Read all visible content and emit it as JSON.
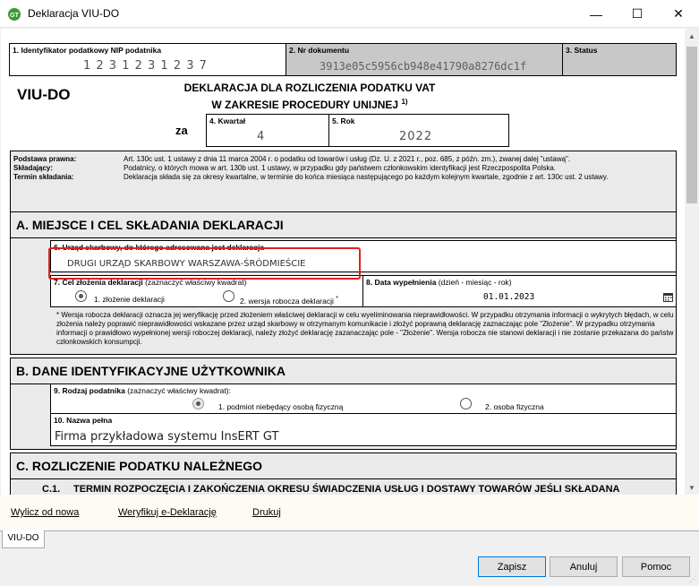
{
  "window": {
    "title": "Deklaracja VIU-DO",
    "minimize": "—",
    "maximize": "☐",
    "close": "✕"
  },
  "header": {
    "nip_label_num": "1.",
    "nip_label": "Identyfikator podatkowy NIP podatnika",
    "nip_value": "1 2 3 1 2 3 1 2 3 7",
    "doc_label_num": "2.",
    "doc_label": "Nr dokumentu",
    "doc_value": "3913e05c5956cb948e41790a8276dc1f",
    "status_label_num": "3.",
    "status_label": "Status",
    "form_code": "VIU-DO",
    "title_line1": "DEKLARACJA DLA ROZLICZENIA PODATKU VAT",
    "title_line2": "W ZAKRESIE PROCEDURY UNIJNEJ",
    "title_sup": "1)",
    "za": "za",
    "quarter_label_num": "4.",
    "quarter_label": "Kwartał",
    "quarter_value": "4",
    "year_label_num": "5.",
    "year_label": "Rok",
    "year_value": "2022"
  },
  "legal": {
    "basis_key": "Podstawa prawna:",
    "basis_val": "Art. 130c ust. 1 ustawy z dnia 11 marca 2004 r. o podatku od towarów i usług (Dz. U. z 2021 r., poz. 685, z późn. zm.), zwanej dalej \"ustawą\".",
    "filer_key": "Składający:",
    "filer_val": "Podatnicy, o których mowa w art. 130b ust. 1 ustawy, w przypadku gdy państwem członkowskim identyfikacji jest Rzeczpospolita Polska.",
    "deadline_key": "Termin składania:",
    "deadline_val": "Deklaracja składa się za okresy kwartalne, w terminie do końca miesiąca następującego po każdym kolejnym kwartale, zgodnie z art. 130c ust. 2 ustawy."
  },
  "section_a": {
    "title": "A. MIEJSCE I CEL SKŁADANIA DEKLARACJI",
    "office_label": "6. Urząd skarbowy, do którego adresowana jest deklaracja",
    "office_value": "DRUGI URZĄD SKARBOWY WARSZAWA-ŚRÓDMIEŚCIE",
    "purpose_label": "7. Cel złożenia deklaracji",
    "purpose_hint": "(zaznaczyć właściwy kwadrat)",
    "purpose_opt1": "1. złożenie deklaracji",
    "purpose_opt2": "2. wersja robocza deklaracji",
    "purpose_opt2_sup": "*",
    "date_label": "8. Data wypełnienia",
    "date_hint": "(dzień - miesiąc - rok)",
    "date_value": "01.01.2023",
    "note": "* Wersja robocza deklaracji oznacza jej weryfikację przed złożeniem właściwej deklaracji w celu wyeliminowania nieprawidłowości. W przypadku otrzymania informacji o wykrytych błędach, w celu złożenia należy poprawić nieprawidłowości wskazane przez urząd skarbowy w otrzymanym komunikacie i złożyć poprawną deklarację zaznaczając pole \"Złożenie\". W przypadku otrzymania informacji o prawidłowo wypełnionej wersji roboczej deklaracji, należy złożyć deklarację zazanaczając pole - \"Złożenie\". Wersja robocza nie stanowi deklaracji i nie zostanie przekazana do państw członkowskich konsumpcji."
  },
  "section_b": {
    "title": "B. DANE IDENTYFIKACYJNE UŻYTKOWNIKA",
    "type_label": "9. Rodzaj podatnika",
    "type_hint": "(zaznaczyć właściwy kwadrat):",
    "type_opt1": "1. podmiot niebędący osobą fizyczną",
    "type_opt2": "2. osoba fizyczna",
    "name_label": "10. Nazwa pełna",
    "name_value": "Firma przykładowa systemu InsERT GT"
  },
  "section_c": {
    "title": "C. ROZLICZENIE PODATKU NALEŻNEGO",
    "sub_num": "C.1.",
    "sub_title": "TERMIN ROZPOCZĘCIA I ZAKOŃCZENIA OKRESU ŚWIADCZENIA USŁUG I DOSTAWY TOWARÓW JEŚLI SKŁADANA"
  },
  "links": {
    "recalc": "Wylicz od nowa",
    "verify": "Weryfikuj e-Deklarację",
    "print": "Drukuj"
  },
  "tabs": {
    "active": "VIU-DO"
  },
  "buttons": {
    "save": "Zapisz",
    "cancel": "Anuluj",
    "help": "Pomoc"
  },
  "colors": {
    "highlight": "#e02020",
    "gray_field": "#c8c8c8",
    "section_bg": "#eaeaea"
  }
}
